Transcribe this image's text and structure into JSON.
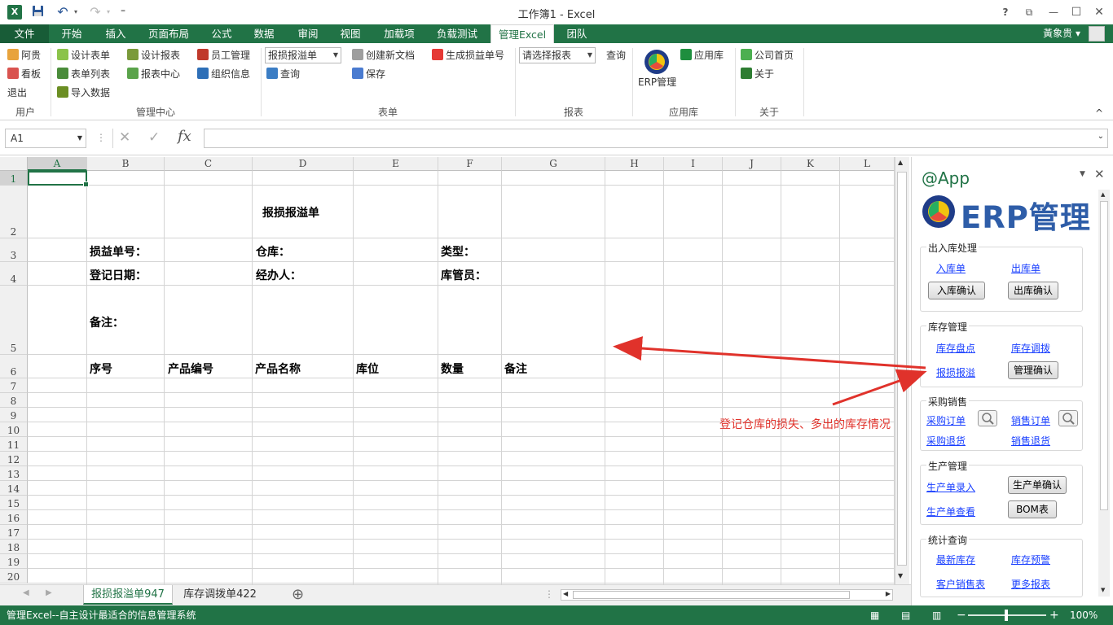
{
  "window": {
    "title": "工作簿1 - Excel",
    "app_icon": "X",
    "help": "?",
    "ribbon_display": "⧉",
    "minimize": "—",
    "maximize": "☐",
    "close": "✕"
  },
  "quick_access": {
    "undo": "↶",
    "redo": "↷",
    "customize": "⁼"
  },
  "tabs": [
    "文件",
    "开始",
    "插入",
    "页面布局",
    "公式",
    "数据",
    "审阅",
    "视图",
    "加载项",
    "负载测试",
    "管理Excel",
    "团队"
  ],
  "active_tab": "管理Excel",
  "user_name": "黃象贵",
  "ribbon": {
    "user_group": {
      "label": "用户",
      "items": [
        "阿贵",
        "看板",
        "退出"
      ]
    },
    "mgmt_group": {
      "label": "管理中心",
      "items": [
        "设计表单",
        "表单列表",
        "导入数据",
        "设计报表",
        "报表中心",
        "员工管理",
        "组织信息"
      ]
    },
    "form_group": {
      "label": "表单",
      "combo": "报损报溢单",
      "query": "查询",
      "create_doc": "创建新文档",
      "save": "保存",
      "gen_no": "生成损益单号"
    },
    "report_group": {
      "label": "报表",
      "combo": "请选择报表",
      "query": "查询"
    },
    "app_group": {
      "label": "应用库",
      "erp": "ERP管理",
      "applib": "应用库"
    },
    "about_group": {
      "label": "关于",
      "home": "公司首页",
      "about": "关于"
    },
    "collapse": "^"
  },
  "formula_bar": {
    "name_box": "A1",
    "cancel": "✕",
    "enter": "✓",
    "fx": "fx",
    "value": ""
  },
  "columns": [
    "A",
    "B",
    "C",
    "D",
    "E",
    "F",
    "G",
    "H",
    "I",
    "J",
    "K",
    "L"
  ],
  "rows": [
    "1",
    "2",
    "3",
    "4",
    "5",
    "6",
    "7",
    "8",
    "9",
    "10",
    "11",
    "12",
    "13",
    "14",
    "15",
    "16",
    "17",
    "18",
    "19",
    "20"
  ],
  "sheet": {
    "title": "报损报溢单",
    "field_no": "损益单号：",
    "field_wh": "仓库：",
    "field_type": "类型：",
    "field_date": "登记日期：",
    "field_handler": "经办人：",
    "field_keeper": "库管员：",
    "field_note": "备注：",
    "headers": [
      "序号",
      "产品编号",
      "产品名称",
      "库位",
      "数量",
      "备注"
    ]
  },
  "sheet_tabs": [
    "报损报溢单947",
    "库存调拨单422"
  ],
  "add_sheet": "⊕",
  "status": {
    "text": "管理Excel--自主设计最适合的信息管理系统",
    "zoom": "100%",
    "minus": "−",
    "plus": "+"
  },
  "pane": {
    "title": "@App",
    "logo_text": "ERP管理",
    "sections": {
      "inout": {
        "label": "出入库处理",
        "in_link": "入库单",
        "out_link": "出库单",
        "in_btn": "入库确认",
        "out_btn": "出库确认"
      },
      "stock": {
        "label": "库存管理",
        "count": "库存盘点",
        "transfer": "库存调拨",
        "loss": "报损报溢",
        "confirm": "管理确认"
      },
      "sales": {
        "label": "采购销售",
        "po": "采购订单",
        "so": "销售订单",
        "po_return": "采购退货",
        "so_return": "销售退货"
      },
      "prod": {
        "label": "生产管理",
        "entry": "生产单录入",
        "confirm": "生产单确认",
        "view": "生产单查看",
        "bom": "BOM表"
      },
      "stats": {
        "label": "统计查询",
        "latest": "最新库存",
        "warn": "库存预警",
        "cust": "客户销售表",
        "more": "更多报表"
      }
    }
  },
  "annotation": "登记仓库的损失、多出的库存情况",
  "colors": {
    "excel_green": "#217346",
    "link_blue": "#1a40ff",
    "annotation_red": "#e0322b"
  }
}
